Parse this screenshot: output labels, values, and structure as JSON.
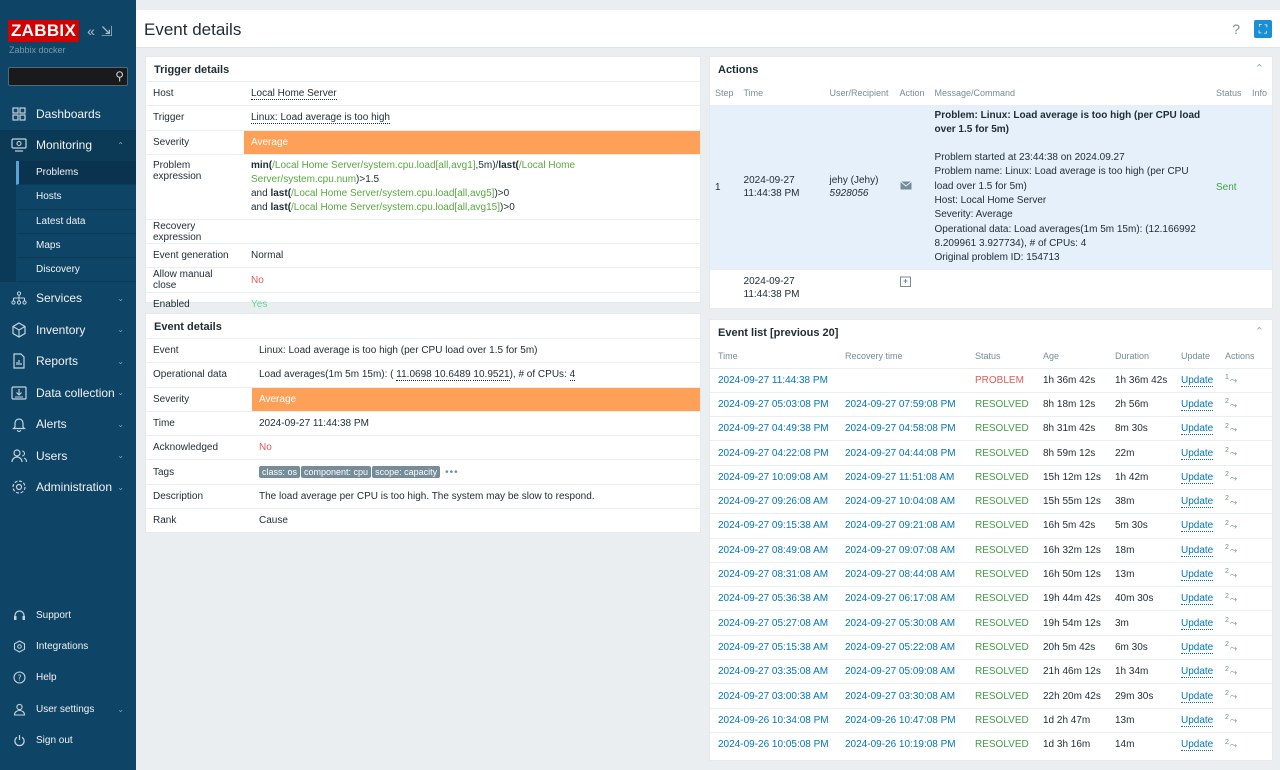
{
  "app": {
    "logo": "ZABBIX",
    "server_name": "Zabbix docker"
  },
  "header": {
    "title": "Event details",
    "help": "?"
  },
  "sidebar": {
    "menu": [
      {
        "label": "Dashboards",
        "icon": "dashboards-icon"
      },
      {
        "label": "Monitoring",
        "icon": "monitoring-icon"
      },
      {
        "label": "Services",
        "icon": "services-icon"
      },
      {
        "label": "Inventory",
        "icon": "inventory-icon"
      },
      {
        "label": "Reports",
        "icon": "reports-icon"
      },
      {
        "label": "Data collection",
        "icon": "data-collection-icon"
      },
      {
        "label": "Alerts",
        "icon": "alerts-icon"
      },
      {
        "label": "Users",
        "icon": "users-icon"
      },
      {
        "label": "Administration",
        "icon": "administration-icon"
      }
    ],
    "monitoring_sub": [
      "Problems",
      "Hosts",
      "Latest data",
      "Maps",
      "Discovery"
    ],
    "bottom": [
      {
        "label": "Support",
        "icon": "support-icon"
      },
      {
        "label": "Integrations",
        "icon": "integrations-icon"
      },
      {
        "label": "Help",
        "icon": "help-icon"
      },
      {
        "label": "User settings",
        "icon": "user-settings-icon"
      },
      {
        "label": "Sign out",
        "icon": "sign-out-icon"
      }
    ]
  },
  "trigger_details": {
    "title": "Trigger details",
    "rows": {
      "host_label": "Host",
      "host": "Local Home Server",
      "trigger_label": "Trigger",
      "trigger": "Linux: Load average is too high",
      "severity_label": "Severity",
      "severity": "Average",
      "problem_expr_label": "Problem expression",
      "expr": {
        "l1_f1": "min(",
        "l1_l1": "/Local Home Server/system.cpu.load[all,avg1]",
        "l1_t1": ",5m)/",
        "l1_f2": "last(",
        "l1_l2": "/Local Home Server/system.cpu.num",
        "l1_t2": ")>1.5",
        "l2_t": "and ",
        "l2_f": "last(",
        "l2_l": "/Local Home Server/system.cpu.load[all,avg5]",
        "l2_e": ")>0",
        "l3_t": "and ",
        "l3_f": "last(",
        "l3_l": "/Local Home Server/system.cpu.load[all,avg15]",
        "l3_e": ")>0"
      },
      "recovery_label": "Recovery expression",
      "event_gen_label": "Event generation",
      "event_gen": "Normal",
      "manual_close_label": "Allow manual close",
      "manual_close": "No",
      "enabled_label": "Enabled",
      "enabled": "Yes"
    }
  },
  "event_details": {
    "title": "Event details",
    "event_label": "Event",
    "event": "Linux: Load average is too high (per CPU load over 1.5 for 5m)",
    "opdata_label": "Operational data",
    "opdata_pre": "Load averages(1m 5m 15m): (",
    "op_v1": "11.0698",
    "op_v2": "10.6489",
    "op_v3": "10.9521",
    "opdata_mid": "), # of CPUs:",
    "op_cpus": "4",
    "severity_label": "Severity",
    "severity": "Average",
    "time_label": "Time",
    "time": "2024-09-27 11:44:38 PM",
    "ack_label": "Acknowledged",
    "ack": "No",
    "tags_label": "Tags",
    "tags": [
      "class: os",
      "component: cpu",
      "scope: capacity"
    ],
    "tags_more": "•••",
    "desc_label": "Description",
    "desc": "The load average per CPU is too high. The system may be slow to respond.",
    "rank_label": "Rank",
    "rank": "Cause"
  },
  "actions": {
    "title": "Actions",
    "headers": [
      "Step",
      "Time",
      "User/Recipient",
      "Action",
      "Message/Command",
      "Status",
      "Info"
    ],
    "row1": {
      "step": "1",
      "date": "2024-09-27",
      "time": "11:44:38 PM",
      "user": "jehy (Jehy)",
      "recipient": "5928056",
      "msg_title": "Problem: Linux: Load average is too high (per CPU load over 1.5 for 5m)",
      "msg_lines": [
        "Problem started at 23:44:38 on 2024.09.27",
        "Problem name: Linux: Load average is too high (per CPU load over 1.5 for 5m)",
        "Host: Local Home Server",
        "Severity: Average",
        "Operational data: Load averages(1m 5m 15m): (12.166992 8.209961 3.927734), # of CPUs: 4",
        "Original problem ID: 154713"
      ],
      "status": "Sent"
    },
    "row2": {
      "date": "2024-09-27",
      "time": "11:44:38 PM"
    }
  },
  "event_list": {
    "title": "Event list [previous 20]",
    "headers": [
      "Time",
      "Recovery time",
      "Status",
      "Age",
      "Duration",
      "Update",
      "Actions"
    ],
    "rows": [
      {
        "time": "2024-09-27 11:44:38 PM",
        "recovery": "",
        "status": "PROBLEM",
        "age": "1h 36m 42s",
        "duration": "1h 36m 42s",
        "update": "Update",
        "actions": "1"
      },
      {
        "time": "2024-09-27 05:03:08 PM",
        "recovery": "2024-09-27 07:59:08 PM",
        "status": "RESOLVED",
        "age": "8h 18m 12s",
        "duration": "2h 56m",
        "update": "Update",
        "actions": "2"
      },
      {
        "time": "2024-09-27 04:49:38 PM",
        "recovery": "2024-09-27 04:58:08 PM",
        "status": "RESOLVED",
        "age": "8h 31m 42s",
        "duration": "8m 30s",
        "update": "Update",
        "actions": "2"
      },
      {
        "time": "2024-09-27 04:22:08 PM",
        "recovery": "2024-09-27 04:44:08 PM",
        "status": "RESOLVED",
        "age": "8h 59m 12s",
        "duration": "22m",
        "update": "Update",
        "actions": "2"
      },
      {
        "time": "2024-09-27 10:09:08 AM",
        "recovery": "2024-09-27 11:51:08 AM",
        "status": "RESOLVED",
        "age": "15h 12m 12s",
        "duration": "1h 42m",
        "update": "Update",
        "actions": "2"
      },
      {
        "time": "2024-09-27 09:26:08 AM",
        "recovery": "2024-09-27 10:04:08 AM",
        "status": "RESOLVED",
        "age": "15h 55m 12s",
        "duration": "38m",
        "update": "Update",
        "actions": "2"
      },
      {
        "time": "2024-09-27 09:15:38 AM",
        "recovery": "2024-09-27 09:21:08 AM",
        "status": "RESOLVED",
        "age": "16h 5m 42s",
        "duration": "5m 30s",
        "update": "Update",
        "actions": "2"
      },
      {
        "time": "2024-09-27 08:49:08 AM",
        "recovery": "2024-09-27 09:07:08 AM",
        "status": "RESOLVED",
        "age": "16h 32m 12s",
        "duration": "18m",
        "update": "Update",
        "actions": "2"
      },
      {
        "time": "2024-09-27 08:31:08 AM",
        "recovery": "2024-09-27 08:44:08 AM",
        "status": "RESOLVED",
        "age": "16h 50m 12s",
        "duration": "13m",
        "update": "Update",
        "actions": "2"
      },
      {
        "time": "2024-09-27 05:36:38 AM",
        "recovery": "2024-09-27 06:17:08 AM",
        "status": "RESOLVED",
        "age": "19h 44m 42s",
        "duration": "40m 30s",
        "update": "Update",
        "actions": "2"
      },
      {
        "time": "2024-09-27 05:27:08 AM",
        "recovery": "2024-09-27 05:30:08 AM",
        "status": "RESOLVED",
        "age": "19h 54m 12s",
        "duration": "3m",
        "update": "Update",
        "actions": "2"
      },
      {
        "time": "2024-09-27 05:15:38 AM",
        "recovery": "2024-09-27 05:22:08 AM",
        "status": "RESOLVED",
        "age": "20h 5m 42s",
        "duration": "6m 30s",
        "update": "Update",
        "actions": "2"
      },
      {
        "time": "2024-09-27 03:35:08 AM",
        "recovery": "2024-09-27 05:09:08 AM",
        "status": "RESOLVED",
        "age": "21h 46m 12s",
        "duration": "1h 34m",
        "update": "Update",
        "actions": "2"
      },
      {
        "time": "2024-09-27 03:00:38 AM",
        "recovery": "2024-09-27 03:30:08 AM",
        "status": "RESOLVED",
        "age": "22h 20m 42s",
        "duration": "29m 30s",
        "update": "Update",
        "actions": "2"
      },
      {
        "time": "2024-09-26 10:34:08 PM",
        "recovery": "2024-09-26 10:47:08 PM",
        "status": "RESOLVED",
        "age": "1d 2h 47m",
        "duration": "13m",
        "update": "Update",
        "actions": "2"
      },
      {
        "time": "2024-09-26 10:05:08 PM",
        "recovery": "2024-09-26 10:19:08 PM",
        "status": "RESOLVED",
        "age": "1d 3h 16m",
        "duration": "14m",
        "update": "Update",
        "actions": "2"
      }
    ]
  }
}
